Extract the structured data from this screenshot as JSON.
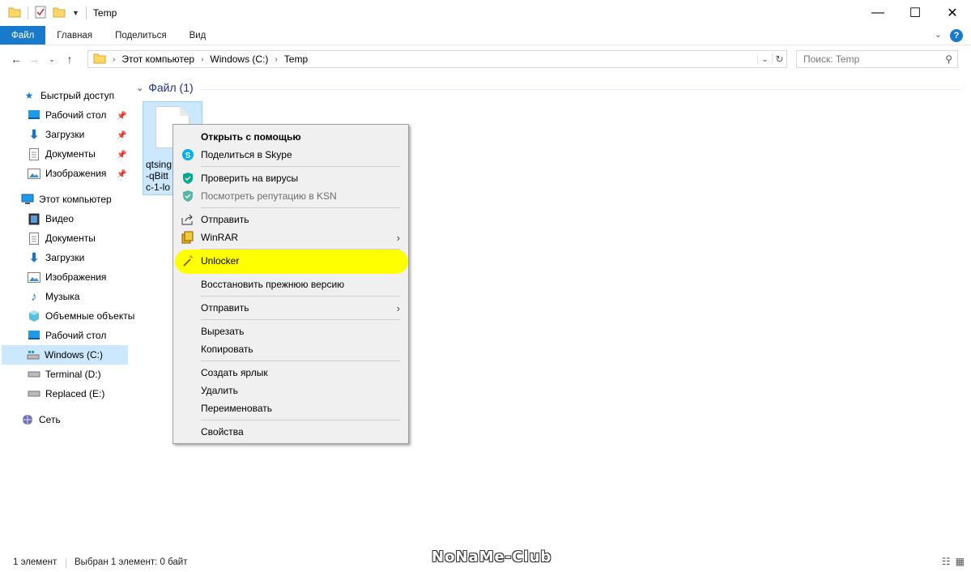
{
  "window": {
    "title": "Temp"
  },
  "ribbon": {
    "tabs": [
      "Файл",
      "Главная",
      "Поделиться",
      "Вид"
    ]
  },
  "address": {
    "crumbs": [
      "Этот компьютер",
      "Windows (C:)",
      "Temp"
    ]
  },
  "search": {
    "placeholder": "Поиск: Temp"
  },
  "sidebar": {
    "quick_access": "Быстрый доступ",
    "quick_items": [
      "Рабочий стол",
      "Загрузки",
      "Документы",
      "Изображения"
    ],
    "this_pc": "Этот компьютер",
    "pc_items": [
      "Видео",
      "Документы",
      "Загрузки",
      "Изображения",
      "Музыка",
      "Объемные объекты",
      "Рабочий стол",
      "Windows (C:)",
      "Terminal (D:)",
      "Replaced (E:)"
    ],
    "network": "Сеть"
  },
  "main": {
    "group_header": "Файл (1)",
    "file_name": "qtsing\n-qBitt\nc-1-lo"
  },
  "context_menu": {
    "open_with": "Открыть с помощью",
    "share_skype": "Поделиться в Skype",
    "scan_virus": "Проверить на вирусы",
    "ksn_reputation": "Посмотреть репутацию в KSN",
    "share": "Отправить",
    "winrar": "WinRAR",
    "unlocker": "Unlocker",
    "restore_version": "Восстановить прежнюю версию",
    "send_to": "Отправить",
    "cut": "Вырезать",
    "copy": "Копировать",
    "create_shortcut": "Создать ярлык",
    "delete": "Удалить",
    "rename": "Переименовать",
    "properties": "Свойства"
  },
  "status": {
    "count": "1 элемент",
    "selected": "Выбран 1 элемент: 0 байт"
  },
  "watermark": "NoNaMe-Club",
  "colors": {
    "accent": "#1979ca",
    "selection": "#cce8ff",
    "highlight": "#ffff00"
  }
}
